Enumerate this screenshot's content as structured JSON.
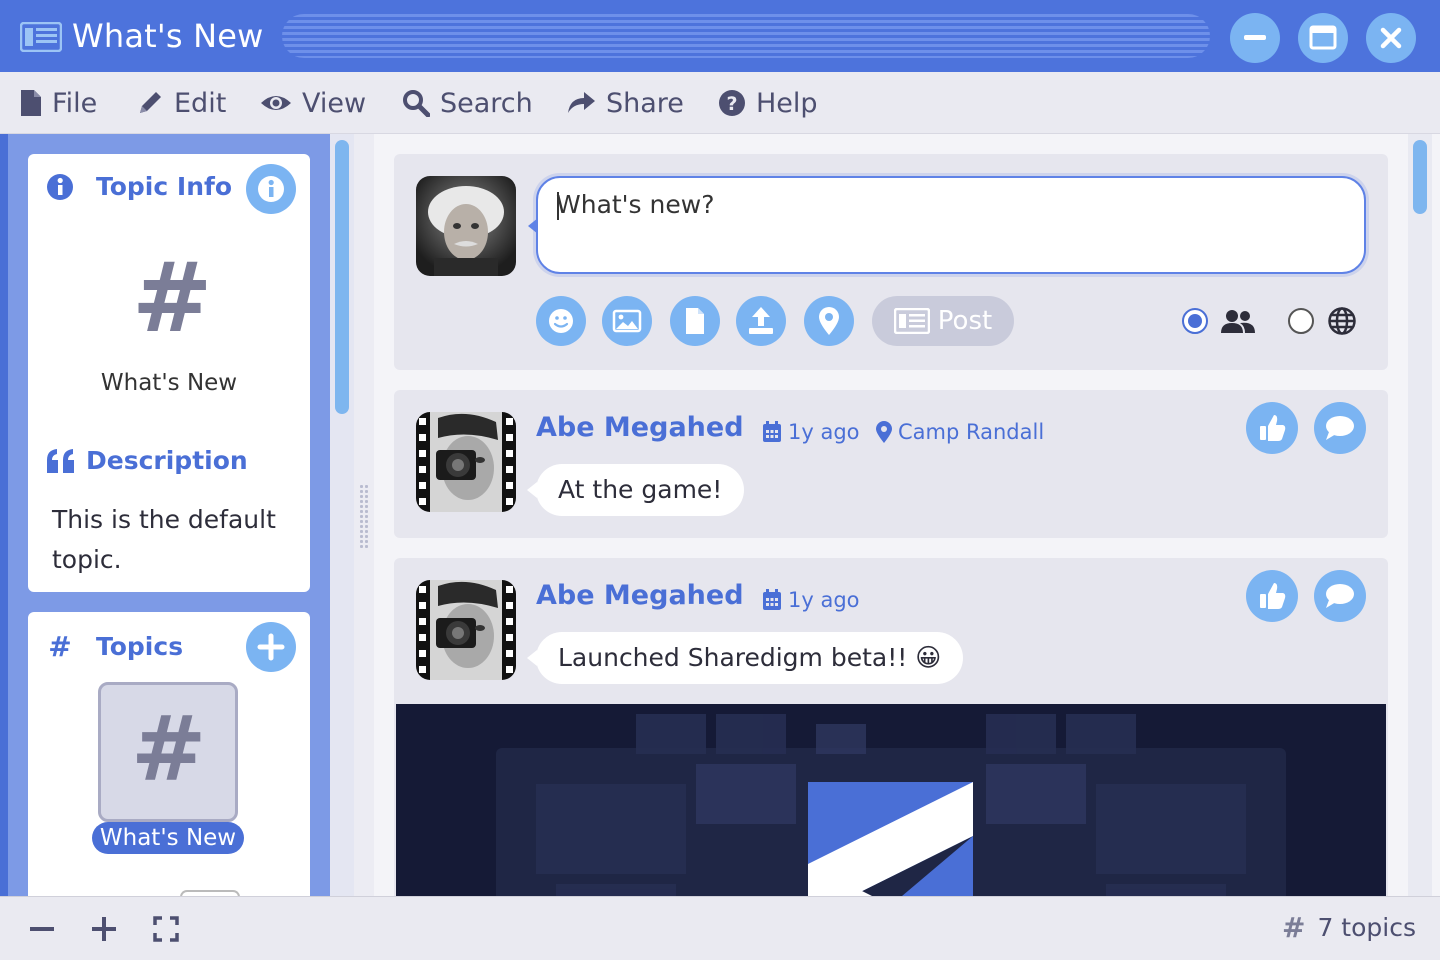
{
  "window": {
    "title": "What's New"
  },
  "menu": {
    "file": "File",
    "edit": "Edit",
    "view": "View",
    "search": "Search",
    "share": "Share",
    "help": "Help"
  },
  "topic_info": {
    "heading": "Topic Info",
    "topic_name": "What's New",
    "description_heading": "Description",
    "description": "This is the default topic."
  },
  "topics": {
    "heading": "Topics",
    "items": [
      {
        "label": "What's New"
      }
    ]
  },
  "composer": {
    "placeholder": "What's new?",
    "post_label": "Post",
    "visibility": "friends"
  },
  "posts": [
    {
      "author": "Abe Megahed",
      "time": "1y ago",
      "location": "Camp Randall",
      "text": "At the game!"
    },
    {
      "author": "Abe Megahed",
      "time": "1y ago",
      "location": "",
      "text": "Launched Sharedigm beta!! 😀"
    }
  ],
  "status": {
    "topic_count": "7 topics"
  },
  "colors": {
    "accent": "#4a6fd6",
    "button": "#7bb4f2",
    "sidebar": "#7d9ae6"
  }
}
